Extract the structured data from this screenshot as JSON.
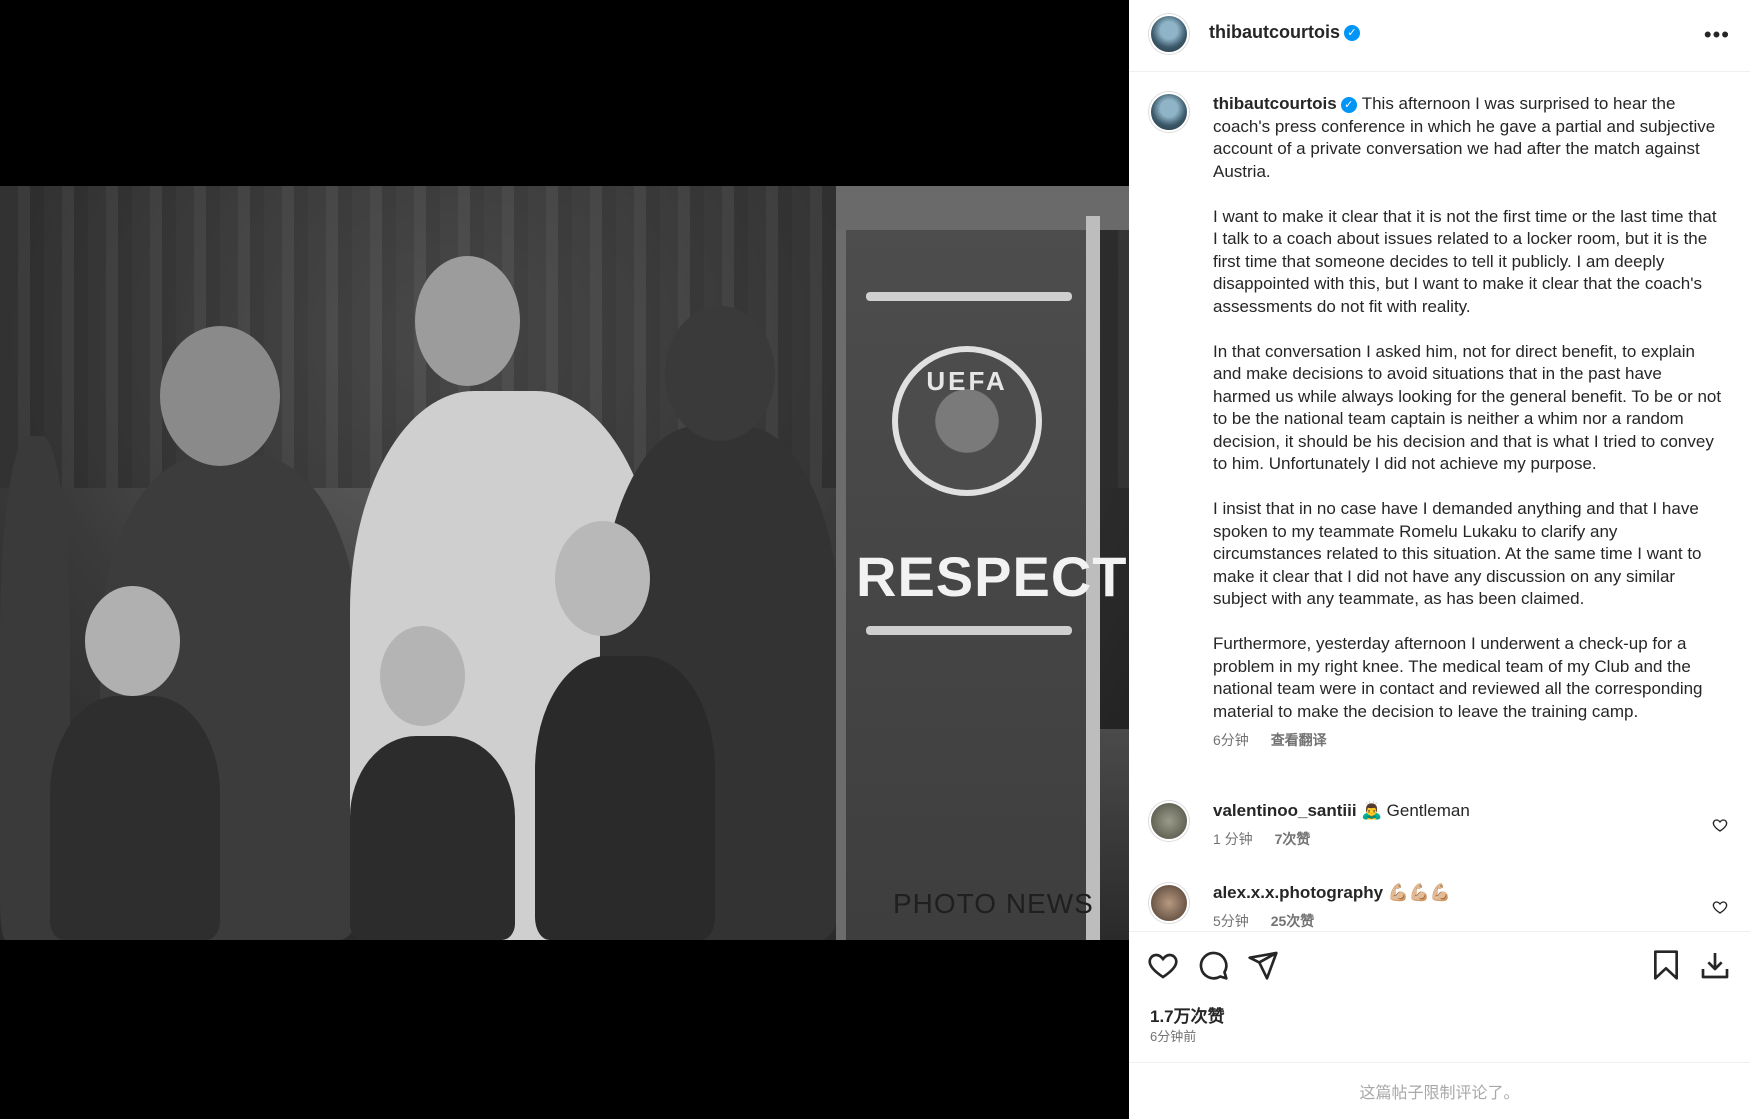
{
  "post": {
    "username": "thibautcourtois",
    "verified_icon": "verified-badge-icon",
    "more_icon": "more-options-icon"
  },
  "image": {
    "board_text_top": "UEFA",
    "board_text_main": "RESPECT",
    "watermark": "PHOTO NEWS"
  },
  "caption": {
    "username": "thibautcourtois",
    "paragraphs": [
      "This afternoon I was surprised to hear the coach's press conference in which he gave a partial and subjective account of a private conversation we had after the match against Austria.",
      "I want to make it clear that it is not the first time or the last time that I talk to a coach about issues related to a locker room, but it is the first time that someone decides to tell it publicly. I am deeply disappointed with this, but I want to make it clear that the coach's assessments do not fit with reality.",
      "In that conversation I asked him, not for direct benefit, to explain and make decisions to avoid situations that in the past have harmed us while always looking for the general benefit. To be or not to be the national team captain is neither a whim nor a random decision, it should be his decision and that is what I tried to convey to him. Unfortunately I did not achieve my purpose.",
      "I insist that in no case have I demanded anything and that I have spoken to my teammate Romelu Lukaku to clarify any circumstances related to this situation. At the same time I want to make it clear that I did not have any discussion on any similar subject with any teammate, as has been claimed.",
      "Furthermore, yesterday afternoon I underwent a check-up for a problem in my right knee. The medical team of my Club and the national team were in contact and reviewed all the corresponding material to make the decision to leave the training camp."
    ],
    "time": "6分钟",
    "translate": "查看翻译"
  },
  "comments": [
    {
      "username": "valentinoo_santiii",
      "emoji": "🙇‍♂️",
      "text": "Gentleman",
      "time": "1 分钟",
      "likes": "7次赞"
    },
    {
      "username": "alex.x.x.photography",
      "emoji": "💪🏼💪🏼💪🏼",
      "text": "",
      "time": "5分钟",
      "likes": "25次赞"
    }
  ],
  "actions": {
    "like_icon": "heart-icon",
    "comment_icon": "comment-icon",
    "share_icon": "share-icon",
    "save_icon": "bookmark-icon",
    "download_icon": "download-icon",
    "likes_count": "1.7万次赞",
    "posted_time": "6分钟前",
    "comments_limited": "这篇帖子限制评论了。"
  }
}
